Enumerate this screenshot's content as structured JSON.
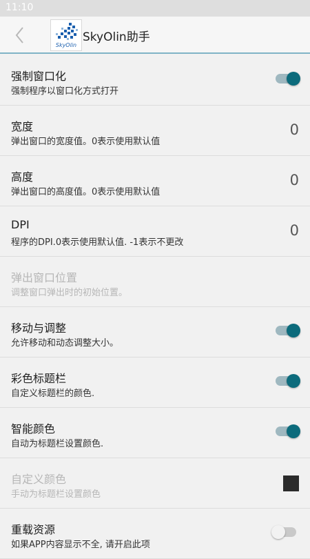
{
  "status_bar": {
    "time": "11:10"
  },
  "app_bar": {
    "title": "SkyOlin助手",
    "logo_text": "SkyOlin"
  },
  "colors": {
    "accent": "#0c6b7c",
    "track_on": "#9fb8c0",
    "swatch": "#2b2b2b"
  },
  "settings": [
    {
      "title": "强制窗口化",
      "summary": "强制程序以窗口化方式打开",
      "control": "switch",
      "checked": true,
      "enabled": true
    },
    {
      "title": "宽度",
      "summary": "弹出窗口的宽度值。0表示使用默认值",
      "control": "value",
      "value": "0",
      "enabled": true
    },
    {
      "title": "高度",
      "summary": "弹出窗口的高度值。0表示使用默认值",
      "control": "value",
      "value": "0",
      "enabled": true
    },
    {
      "title": "DPI",
      "summary": "程序的DPI.0表示使用默认值. -1表示不更改",
      "control": "value",
      "value": "0",
      "enabled": true
    },
    {
      "title": "弹出窗口位置",
      "summary": "调整窗口弹出时的初始位置。",
      "control": "none",
      "enabled": false
    },
    {
      "title": "移动与调整",
      "summary": "允许移动和动态调整大小。",
      "control": "switch",
      "checked": true,
      "enabled": true
    },
    {
      "title": "彩色标题栏",
      "summary": "自定义标题栏的颜色.",
      "control": "switch",
      "checked": true,
      "enabled": true
    },
    {
      "title": "智能颜色",
      "summary": "自动为标题栏设置颜色.",
      "control": "switch",
      "checked": true,
      "enabled": true
    },
    {
      "title": "自定义颜色",
      "summary": "手动为标题栏设置颜色",
      "control": "swatch",
      "enabled": false
    },
    {
      "title": "重载资源",
      "summary": "如果APP内容显示不全, 请开启此项",
      "control": "switch",
      "checked": false,
      "enabled": true
    }
  ]
}
